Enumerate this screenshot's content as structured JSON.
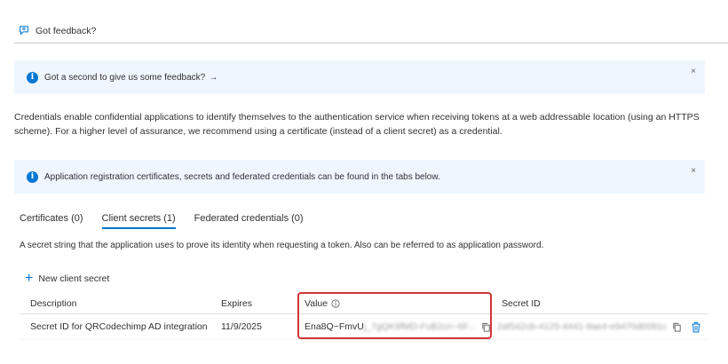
{
  "feedback": {
    "label": "Got feedback?"
  },
  "banner_feedback": {
    "text": "Got a second to give us some feedback?",
    "arrow": "→",
    "close": "×"
  },
  "description": "Credentials enable confidential applications to identify themselves to the authentication service when receiving tokens at a web addressable location (using an HTTPS scheme). For a higher level of assurance, we recommend using a certificate (instead of a client secret) as a credential.",
  "banner_tabs": {
    "text": "Application registration certificates, secrets and federated credentials can be found in the tabs below.",
    "close": "×"
  },
  "tabs": [
    {
      "label": "Certificates (0)"
    },
    {
      "label": "Client secrets (1)"
    },
    {
      "label": "Federated credentials (0)"
    }
  ],
  "secret_description": "A secret string that the application uses to prove its identity when requesting a token. Also can be referred to as application password.",
  "new_secret": {
    "label": "New client secret"
  },
  "table": {
    "headers": {
      "description": "Description",
      "expires": "Expires",
      "value": "Value",
      "secret_id": "Secret ID"
    },
    "rows": [
      {
        "description": "Secret ID for QRCodechimp AD integration",
        "expires": "11/9/2025",
        "value_visible": "Ena8Q~FmvU",
        "value_hidden": "j_7gQK9fMD-FuB2cn~6F...",
        "secret_id_hidden": "2af542cb-4125-4441-9ae4-e9470d0091c"
      }
    ]
  },
  "colors": {
    "accent": "#0078d4",
    "highlight": "#d13438",
    "banner_bg": "#f0f6ff"
  },
  "icons": [
    "feedback-icon",
    "info-icon",
    "close-icon",
    "plus-icon",
    "info-circle-icon",
    "copy-icon",
    "trash-icon"
  ]
}
